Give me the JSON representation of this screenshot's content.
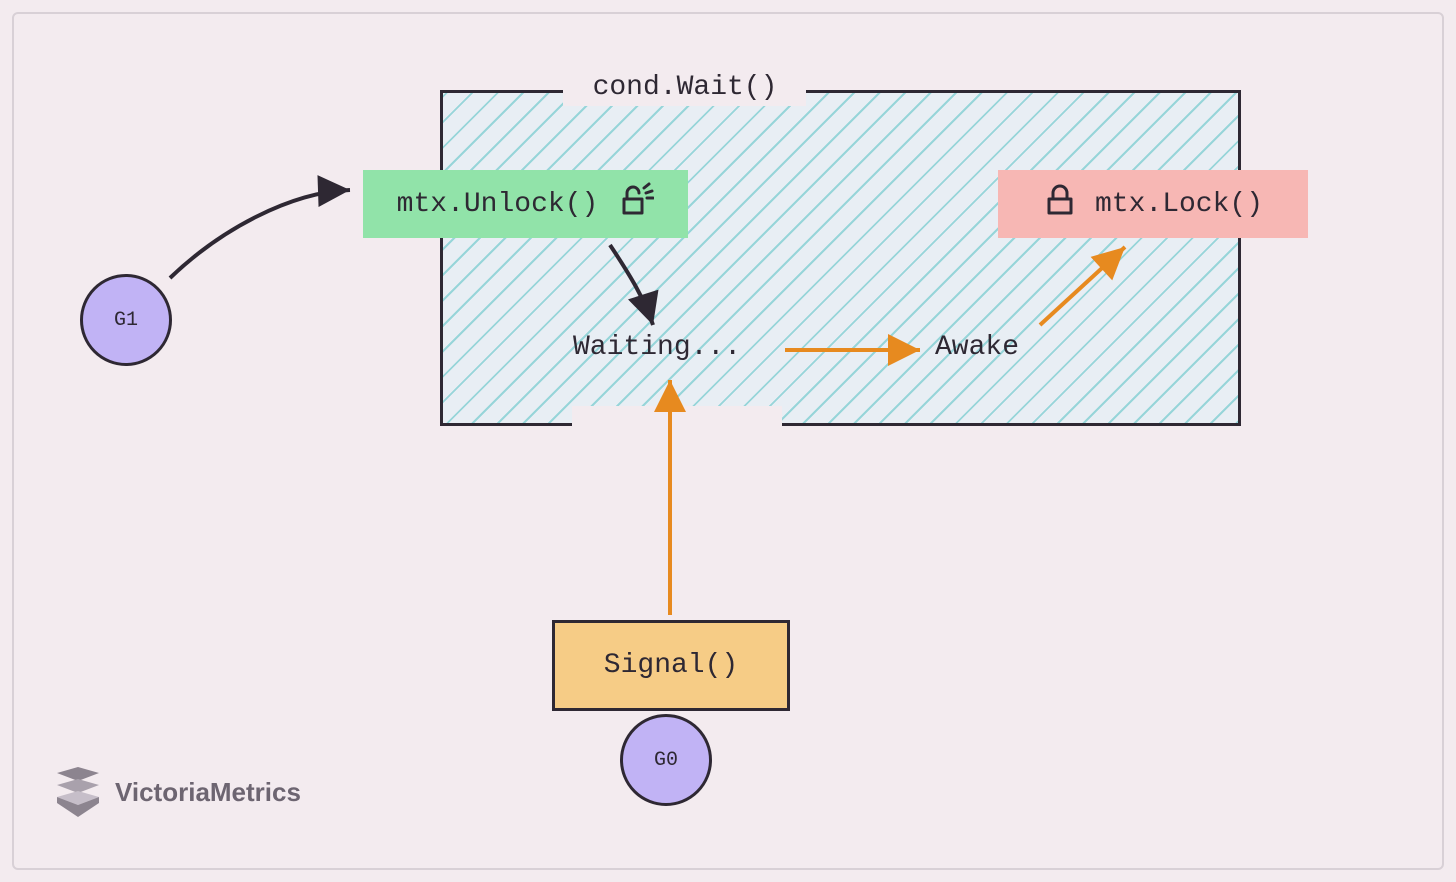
{
  "title": "cond.Wait()",
  "unlock_label": "mtx.Unlock()",
  "lock_label": "mtx.Lock()",
  "waiting": "Waiting...",
  "awake": "Awake",
  "signal": "Signal()",
  "g1": "G1",
  "g0": "G0",
  "brand": "VictoriaMetrics",
  "colors": {
    "bg": "#f3ebef",
    "node_border": "#2e2833",
    "unlock_bg": "#91e3a9",
    "lock_bg": "#f7b7b4",
    "signal_bg": "#f6cc86",
    "circle_bg": "#c1b3f5",
    "hatch": "#97d5d9",
    "arrow_black": "#2e2833",
    "arrow_orange": "#e78a1f"
  }
}
